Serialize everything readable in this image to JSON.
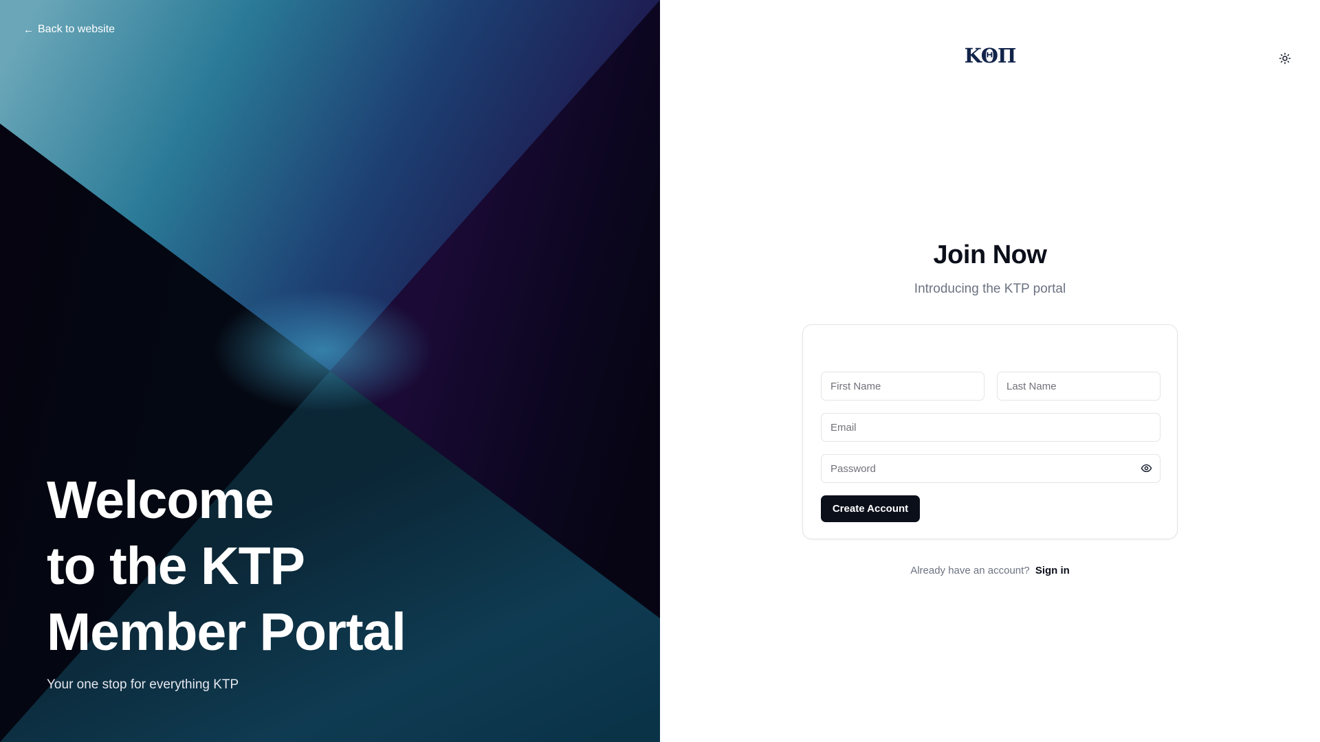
{
  "hero": {
    "back_label": "Back to website",
    "welcome_lines": [
      "Welcome",
      "to the KTP",
      "Member Portal"
    ],
    "tagline": "Your one stop for everything KTP"
  },
  "header": {
    "logo_text": "ΚΘΠ"
  },
  "form": {
    "title": "Join Now",
    "subtitle": "Introducing the KTP portal",
    "first_name_placeholder": "First Name",
    "last_name_placeholder": "Last Name",
    "email_placeholder": "Email",
    "password_placeholder": "Password",
    "submit_label": "Create Account"
  },
  "footer": {
    "prompt": "Already have an account?",
    "signin_label": "Sign in"
  },
  "icons": {
    "back": "arrow-left-icon",
    "theme": "sun-icon",
    "password_visibility": "eye-icon"
  },
  "colors": {
    "primary_button": "#0b0f1a",
    "logo": "#12244a",
    "hero_teal": "#3f8aa8",
    "hero_purple": "#2a0d52"
  }
}
